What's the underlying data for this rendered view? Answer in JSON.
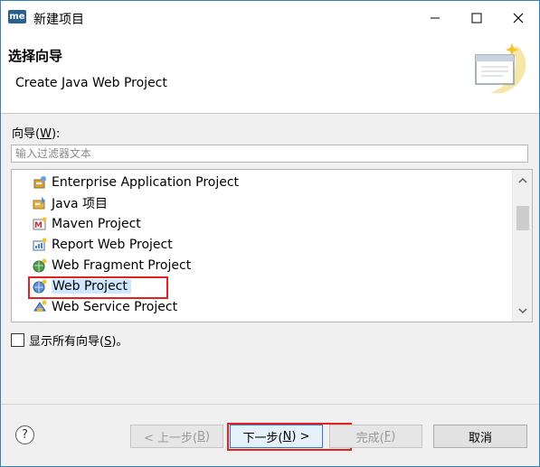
{
  "window": {
    "app_icon_text": "me",
    "title": "新建项目"
  },
  "header": {
    "title": "选择向导",
    "subtitle": "Create Java Web Project"
  },
  "wizards": {
    "label_prefix": "向导(",
    "label_mnemonic": "W",
    "label_suffix": "):",
    "filter_placeholder": "输入过滤器文本",
    "items": [
      {
        "label": "Enterprise Application Project",
        "icon": "enterprise-project-icon"
      },
      {
        "label": "Java 项目",
        "icon": "java-project-icon"
      },
      {
        "label": "Maven Project",
        "icon": "maven-project-icon"
      },
      {
        "label": "Report Web Project",
        "icon": "report-project-icon"
      },
      {
        "label": "Web Fragment Project",
        "icon": "web-fragment-icon"
      },
      {
        "label": "Web Project",
        "icon": "web-project-icon",
        "selected": true
      },
      {
        "label": "Web Service Project",
        "icon": "web-service-icon"
      }
    ]
  },
  "show_all": {
    "prefix": "显示所有向导(",
    "mnemonic": "S",
    "suffix": ")。",
    "checked": false
  },
  "buttons": {
    "help": "?",
    "back_prefix": "< 上一步(",
    "back_mnemonic": "B",
    "back_suffix": ")",
    "next_prefix": "下一步(",
    "next_mnemonic": "N",
    "next_suffix": ") >",
    "finish_prefix": "完成(",
    "finish_mnemonic": "F",
    "finish_suffix": ")",
    "cancel": "取消"
  },
  "colors": {
    "selection": "#cde8ff",
    "highlight_outline": "#e22121",
    "default_button_border": "#2f79d4"
  }
}
